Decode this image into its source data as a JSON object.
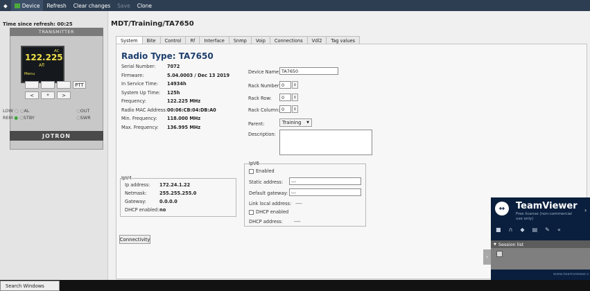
{
  "menubar": {
    "device": "Device",
    "refresh": "Refresh",
    "clear": "Clear changes",
    "save": "Save",
    "clone": "Clone"
  },
  "left": {
    "refresh_label": "Time since refresh:",
    "refresh_value": "00:25",
    "transmitter": "TRANSMITTER",
    "lcd_freq": "122.225",
    "lcd_ac": "AC",
    "lcd_ch": "Afl",
    "lcd_menu": "Menu",
    "ptt": "PTT",
    "btn_left": "<",
    "btn_star": "*",
    "btn_right": ">",
    "low": "LOW",
    "al": "AL",
    "out": "OUT",
    "rem": "REM",
    "stby": "STBY",
    "swr": "SWR",
    "brand": "JOTRON"
  },
  "header": {
    "path": "MDT/Training/TA7650"
  },
  "tabs": [
    "System",
    "Bite",
    "Control",
    "Rf",
    "Interface",
    "Snmp",
    "Voip",
    "Connections",
    "Vdl2",
    "Tag values"
  ],
  "system": {
    "title": "Radio Type: TA7650",
    "rows": [
      {
        "label": "Serial Number:",
        "value": "7072"
      },
      {
        "label": "Firmware:",
        "value": "5.04.0003 / Dec 13 2019"
      },
      {
        "label": "In Service Time:",
        "value": "14934h"
      },
      {
        "label": "System Up Time:",
        "value": "125h"
      },
      {
        "label": "Frequency:",
        "value": "122.225 MHz"
      },
      {
        "label": "Radio MAC Address:",
        "value": "00:06:CB:04:DB:A0"
      },
      {
        "label": "Min. Frequency:",
        "value": "118.000 MHz"
      },
      {
        "label": "Max. Frequency:",
        "value": "136.995 MHz"
      }
    ],
    "device_name_label": "Device Name:",
    "device_name": "TA7650",
    "rack_number_label": "Rack Number:",
    "rack_number": "0",
    "rack_row_label": "Rack Row:",
    "rack_row": "0",
    "rack_column_label": "Rack Column:",
    "rack_column": "0",
    "parent_label": "Parent:",
    "parent": "Training",
    "description_label": "Description:"
  },
  "ipv4": {
    "title": "IpV4",
    "rows": [
      {
        "label": "Ip address:",
        "value": "172.24.1.22"
      },
      {
        "label": "Netmask:",
        "value": "255.255.255.0"
      },
      {
        "label": "Gateway:",
        "value": "0.0.0.0"
      },
      {
        "label": "DHCP enabled:",
        "value": "no"
      }
    ]
  },
  "ipv6": {
    "title": "IpV6",
    "enabled": "Enabled",
    "static_label": "Static address:",
    "static_value": "---",
    "gateway_label": "Default gateway:",
    "gateway_value": "---",
    "link_label": "Link local address:",
    "link_value": "----",
    "dhcp_enabled": "DHCP enabled",
    "dhcp_label": "DHCP address:",
    "dhcp_value": "----"
  },
  "connectivity": "Connectivity",
  "teamviewer": {
    "title": "TeamViewer",
    "subtitle1": "Free license (non-commercial",
    "subtitle2": "use only)",
    "session": "Session list",
    "url": "www.teamviewer.c"
  },
  "taskbar": {
    "search": "Search Windows"
  },
  "colors": {
    "menubar": "#2e3e52",
    "teamviewer": "#0a1f3d",
    "lcd_text": "#f0e04a",
    "title_blue": "#1e3f6e"
  }
}
